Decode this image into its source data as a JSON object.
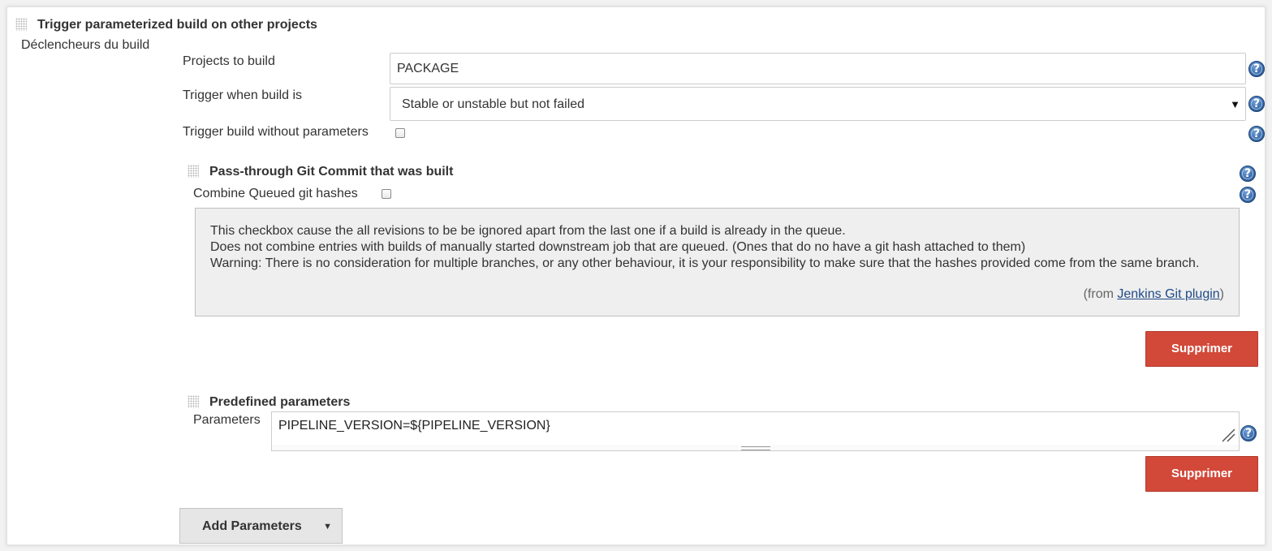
{
  "trigger_section": {
    "title": "Trigger parameterized build on other projects",
    "category_label": "Déclencheurs du build",
    "projects_to_build": {
      "label": "Projects to build",
      "value": "PACKAGE"
    },
    "trigger_when": {
      "label": "Trigger when build is",
      "selected": "Stable or unstable but not failed"
    },
    "without_parameters": {
      "label": "Trigger build without parameters",
      "checked": false
    }
  },
  "git_commit_section": {
    "title": "Pass-through Git Commit that was built",
    "combine_label": "Combine Queued git hashes",
    "combine_checked": false,
    "help": {
      "line1": "This checkbox cause the all revisions to be be ignored apart from the last one if a build is already in the queue.",
      "line2": "Does not combine entries with builds of manually started downstream job that are queued. (Ones that do no have a git hash attached to them)",
      "line3": "Warning: There is no consideration for multiple branches, or any other behaviour, it is your responsibility to make sure that the hashes provided come from the same branch.",
      "from_prefix": "(from ",
      "from_link": "Jenkins Git plugin",
      "from_suffix": ")"
    },
    "delete_label": "Supprimer"
  },
  "predefined_section": {
    "title": "Predefined parameters",
    "parameters_label": "Parameters",
    "parameters_value": "PIPELINE_VERSION=${PIPELINE_VERSION}",
    "delete_label": "Supprimer"
  },
  "add_parameters": {
    "label": "Add Parameters"
  },
  "icons": {
    "help": "help-icon",
    "dropdown": "caret-down-icon",
    "drag": "drag-handle-icon"
  },
  "colors": {
    "danger": "#d24939",
    "help_blue": "#3568a8",
    "link": "#204a87"
  }
}
